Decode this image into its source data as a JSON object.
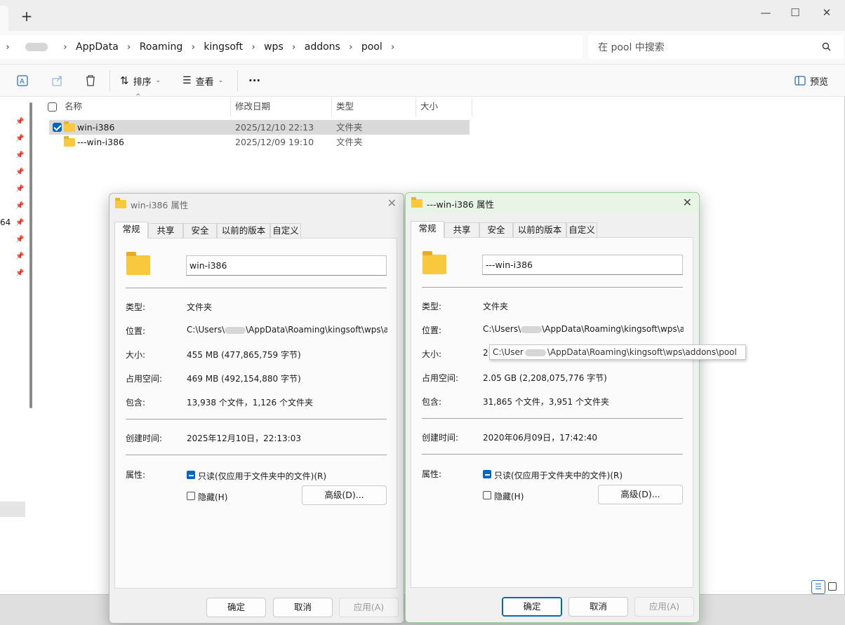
{
  "window": {
    "new_tab": "+",
    "minimize": "—",
    "maximize": "☐",
    "close": "✕"
  },
  "address": {
    "segments": [
      "AppData",
      "Roaming",
      "kingsoft",
      "wps",
      "addons",
      "pool"
    ],
    "search_placeholder": "在 pool 中搜索"
  },
  "toolbar": {
    "sort_label": "排序",
    "view_label": "查看",
    "more": "···",
    "preview_label": "预览"
  },
  "nav": {
    "partial_text": "64"
  },
  "columns": {
    "name": "名称",
    "modified": "修改日期",
    "type": "类型",
    "size": "大小"
  },
  "files": [
    {
      "name": "win-i386",
      "modified": "2025/12/10 22:13",
      "type": "文件夹",
      "selected": true
    },
    {
      "name": "---win-i386",
      "modified": "2025/12/09 19:10",
      "type": "文件夹",
      "selected": false
    }
  ],
  "dialog_left": {
    "title": "win-i386 属性",
    "tabs": [
      "常规",
      "共享",
      "安全",
      "以前的版本",
      "自定义"
    ],
    "name": "win-i386",
    "type_label": "类型:",
    "type_value": "文件夹",
    "location_label": "位置:",
    "location_prefix": "C:\\Users\\",
    "location_suffix": "\\AppData\\Roaming\\kingsoft\\wps\\a",
    "size_label": "大小:",
    "size_value": "455 MB (477,865,759 字节)",
    "disk_label": "占用空间:",
    "disk_value": "469 MB (492,154,880 字节)",
    "contains_label": "包含:",
    "contains_value": "13,938 个文件，1,126 个文件夹",
    "created_label": "创建时间:",
    "created_value": "2025年12月10日，22:13:03",
    "attr_label": "属性:",
    "readonly_label": "只读(仅应用于文件夹中的文件)(R)",
    "hidden_label": "隐藏(H)",
    "advanced_label": "高级(D)...",
    "ok": "确定",
    "cancel": "取消",
    "apply": "应用(A)"
  },
  "dialog_right": {
    "title": "---win-i386 属性",
    "tabs": [
      "常规",
      "共享",
      "安全",
      "以前的版本",
      "自定义"
    ],
    "name": "---win-i386",
    "type_label": "类型:",
    "type_value": "文件夹",
    "location_label": "位置:",
    "location_prefix": "C:\\Users\\",
    "location_suffix": "\\AppData\\Roaming\\kingsoft\\wps\\a",
    "size_label": "大小:",
    "size_value_partial": "2",
    "disk_label": "占用空间:",
    "disk_value": "2.05 GB (2,208,075,776 字节)",
    "contains_label": "包含:",
    "contains_value": "31,865 个文件，3,951 个文件夹",
    "created_label": "创建时间:",
    "created_value": "2020年06月09日，17:42:40",
    "attr_label": "属性:",
    "readonly_label": "只读(仅应用于文件夹中的文件)(R)",
    "hidden_label": "隐藏(H)",
    "advanced_label": "高级(D)...",
    "ok": "确定",
    "cancel": "取消",
    "apply": "应用(A)"
  },
  "tooltip": {
    "prefix": "C:\\User",
    "suffix": "\\AppData\\Roaming\\kingsoft\\wps\\addons\\pool"
  }
}
